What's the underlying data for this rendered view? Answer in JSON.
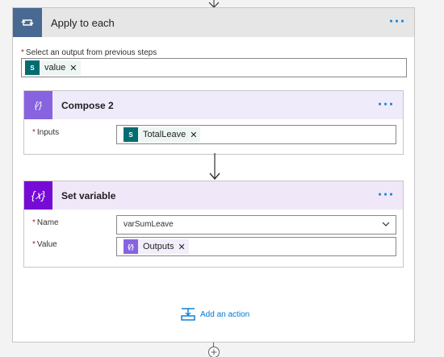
{
  "outer": {
    "title": "Apply to each",
    "menu": "···"
  },
  "select": {
    "label": "Select an output from previous steps",
    "required": "*",
    "token": {
      "icon_text": "S",
      "label": "value",
      "remove": "✕"
    }
  },
  "compose": {
    "title": "Compose 2",
    "menu": "···",
    "icon_text": "{⁄}",
    "inputs": {
      "label": "Inputs",
      "required": "*",
      "token": {
        "icon_text": "S",
        "label": "TotalLeave",
        "remove": "✕"
      }
    }
  },
  "setvar": {
    "title": "Set variable",
    "menu": "···",
    "icon_text": "{𝑥}",
    "name": {
      "label": "Name",
      "required": "*",
      "value": "varSumLeave"
    },
    "value": {
      "label": "Value",
      "required": "*",
      "token": {
        "icon_text": "{⁄}",
        "label": "Outputs",
        "remove": "✕"
      }
    }
  },
  "add_action": {
    "label": "Add an action"
  },
  "colors": {
    "loop": "#486991",
    "sharepoint": "#036c70",
    "compose": "#8763e0",
    "variable": "#770bd6",
    "link": "#0078d4"
  }
}
